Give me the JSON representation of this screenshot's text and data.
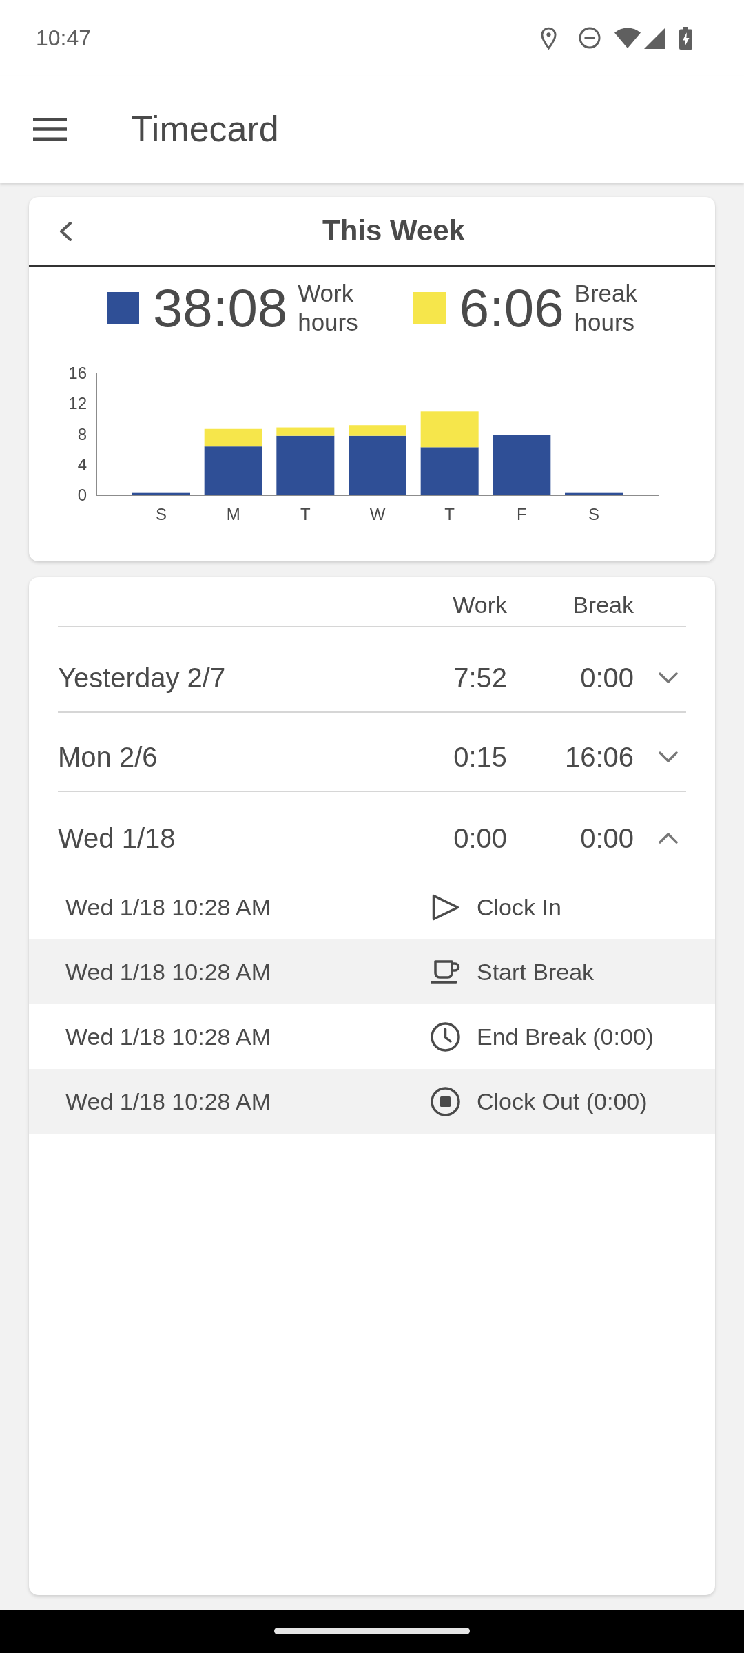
{
  "status_bar": {
    "time": "10:47"
  },
  "app_bar": {
    "title": "Timecard"
  },
  "week_card": {
    "title": "This Week",
    "totals": [
      {
        "value": "38:08",
        "label": "Work hours",
        "color": "#2f4f96"
      },
      {
        "value": "6:06",
        "label": "Break hours",
        "color": "#f6e64b"
      }
    ],
    "chart_data": {
      "type": "bar",
      "categories": [
        "S",
        "M",
        "T",
        "W",
        "T",
        "F",
        "S"
      ],
      "series": [
        {
          "color": "#2f4f96",
          "values": [
            0.3,
            6.4,
            7.8,
            7.8,
            6.3,
            7.9,
            0.3
          ]
        },
        {
          "color": "#f6e64b",
          "values": [
            0,
            2.3,
            1.1,
            1.4,
            4.7,
            0,
            0
          ]
        }
      ],
      "ylim": [
        0,
        16
      ],
      "yticks": [
        0,
        4,
        8,
        12,
        16
      ],
      "stacked": true
    }
  },
  "days_table": {
    "columns": [
      "Work",
      "Break"
    ],
    "rows": [
      {
        "day": "Yesterday 2/7",
        "work": "7:52",
        "break": "0:00",
        "expanded": false
      },
      {
        "day": "Mon 2/6",
        "work": "0:15",
        "break": "16:06",
        "expanded": false
      },
      {
        "day": "Wed 1/18",
        "work": "0:00",
        "break": "0:00",
        "expanded": true,
        "events": [
          {
            "time": "Wed 1/18 10:28 AM",
            "kind": "clock_in",
            "action": "Clock In"
          },
          {
            "time": "Wed 1/18 10:28 AM",
            "kind": "start_break",
            "action": "Start Break"
          },
          {
            "time": "Wed 1/18 10:28 AM",
            "kind": "end_break",
            "action": "End Break (0:00)"
          },
          {
            "time": "Wed 1/18 10:28 AM",
            "kind": "clock_out",
            "action": "Clock Out (0:00)"
          }
        ]
      }
    ]
  }
}
